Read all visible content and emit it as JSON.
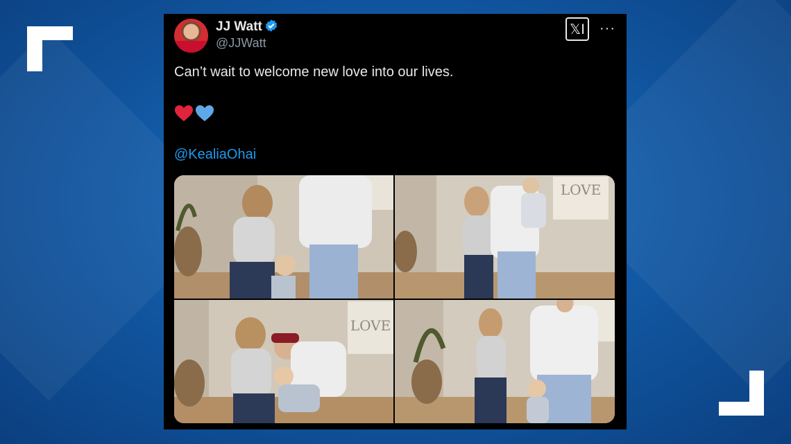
{
  "tweet": {
    "name": "JJ Watt",
    "handle": "@JJWatt",
    "text": "Can’t wait to welcome new love into our lives.",
    "mention": "@KealiaOhai",
    "x_logo": "𝕏Ⅰ",
    "more": "···"
  },
  "icons": {
    "verified": "verified-badge-icon",
    "hearts": [
      "red-heart-icon",
      "blue-heart-icon"
    ]
  },
  "colors": {
    "background": "#125aa6",
    "card": "#000000",
    "text": "#e7e9ea",
    "secondary": "#8b98a5",
    "link": "#1d9bf0",
    "red_heart": "#e0243b",
    "blue_heart": "#5ea8e8"
  },
  "photos": {
    "love_sign_letters": "LOVE"
  }
}
